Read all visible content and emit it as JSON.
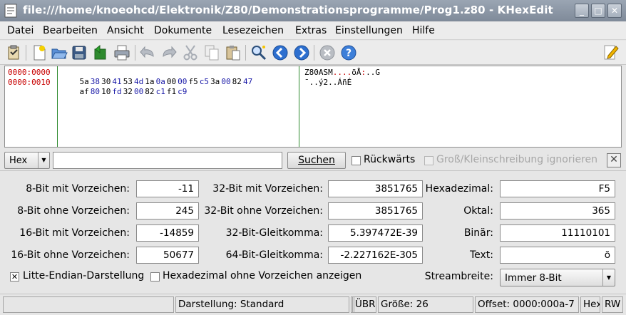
{
  "window": {
    "title": "file:///home/knoeohcd/Elektronik/Z80/Demonstrationsprogramme/Prog1.z80 - KHexEdit",
    "min_glyph": "_",
    "max_glyph": "□",
    "close_glyph": "✕"
  },
  "menu": {
    "items": [
      "Datei",
      "Bearbeiten",
      "Ansicht",
      "Dokumente",
      "Lesezeichen",
      "Extras",
      "Einstellungen",
      "Hilfe"
    ]
  },
  "hex": {
    "offsets": [
      "0000:0000",
      "0000:0010"
    ],
    "rows": [
      [
        "5a",
        "38",
        "30",
        "41",
        "53",
        "4d",
        "1a",
        "0a",
        "00",
        "00",
        "f5",
        "c5",
        "3a",
        "00",
        "82",
        "47"
      ],
      [
        "af",
        "80",
        "10",
        "fd",
        "32",
        "00",
        "82",
        "c1",
        "f1",
        "c9"
      ]
    ],
    "ascii": [
      [
        "Z80ASM",
        "....",
        "õÅ",
        ":",
        "..",
        "G"
      ],
      [
        "¯..ý2..ÁñÉ"
      ]
    ]
  },
  "search": {
    "mode": "Hex",
    "input_value": "",
    "find_label": "Suchen",
    "backwards_label": "Rückwärts",
    "ignore_case_label": "Groß/Kleinschreibung ignorieren",
    "close_glyph": "✕"
  },
  "values": {
    "int8_signed_label": "8-Bit mit Vorzeichen:",
    "int8_signed": "-11",
    "int8_unsigned_label": "8-Bit ohne Vorzeichen:",
    "int8_unsigned": "245",
    "int16_signed_label": "16-Bit mit Vorzeichen:",
    "int16_signed": "-14859",
    "int16_unsigned_label": "16-Bit ohne Vorzeichen:",
    "int16_unsigned": "50677",
    "int32_signed_label": "32-Bit mit Vorzeichen:",
    "int32_signed": "3851765",
    "int32_unsigned_label": "32-Bit ohne Vorzeichen:",
    "int32_unsigned": "3851765",
    "float32_label": "32-Bit-Gleitkomma:",
    "float32": "5.397472E-39",
    "float64_label": "64-Bit-Gleitkomma:",
    "float64": "-2.227162E-305",
    "hex_label": "Hexadezimal:",
    "hex": "F5",
    "oct_label": "Oktal:",
    "oct": "365",
    "bin_label": "Binär:",
    "bin": "11110101",
    "text_label": "Text:",
    "text": "õ",
    "little_endian_label": "Litte-Endian-Darstellung",
    "unsigned_hex_label": "Hexadezimal ohne Vorzeichen anzeigen",
    "stream_label": "Streambreite:",
    "stream_value": "Immer 8-Bit"
  },
  "status": {
    "display": "Darstellung: Standard",
    "overwrite": "ÜBR",
    "size": "Größe: 26",
    "offset": "Offset: 0000:000a-7",
    "mode": "Hex",
    "rw": "RW"
  },
  "colors": {
    "offset": "#c80000",
    "hex_digit_blue": "#1a1aa8",
    "column_line": "#2d8a2d"
  }
}
